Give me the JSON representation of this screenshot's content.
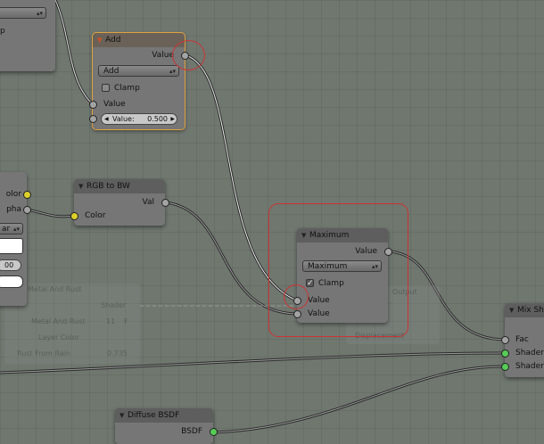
{
  "nodes": {
    "add": {
      "title": "Add",
      "output_label": "Value",
      "operation": "Add",
      "clamp_label": "Clamp",
      "input_label": "Value",
      "slider_label": "Value:",
      "slider_value": "0.500"
    },
    "rgb_to_bw": {
      "title": "RGB to BW",
      "output_label": "Val",
      "input_label": "Color"
    },
    "maximum": {
      "title": "Maximum",
      "output_label": "Value",
      "operation": "Maximum",
      "clamp_label": "Clamp",
      "input1_label": "Value",
      "input2_label": "Value"
    },
    "diffuse": {
      "title": "Diffuse BSDF",
      "output_label": "BSDF"
    },
    "mix_shader": {
      "title": "Mix Sha",
      "input_fac": "Fac",
      "input_shader1": "Shader",
      "input_shader2": "Shader"
    },
    "left_top": {
      "text": "p"
    },
    "left_texture": {
      "out_color": "olor",
      "out_alpha": "pha",
      "field_value": "ar",
      "number_value": "00"
    },
    "ghost_frame": {
      "title": "Metal And Rust",
      "shader_label": "Shader",
      "material_name": "Metal And Rust",
      "user_count": "11",
      "fake_user": "F",
      "layer_color": "Layer Color",
      "rust_label": "Rust From Rain",
      "rust_value": "0.735",
      "output_title": "Output",
      "displacement": "Displacement"
    }
  },
  "colors": {
    "background": "#6f776f",
    "node_body": "#767676",
    "node_header": "#5e5e5e",
    "wire": "#2a2a2a",
    "wire_highlight": "#e8e8e8",
    "socket_value": "#a3a3a3",
    "socket_color": "#dcd02a",
    "socket_shader": "#56cc56",
    "annotation_red": "#cc3333",
    "selected_outline": "#e0a040"
  },
  "icons": [
    "collapse-arrow-icon",
    "dropdown-arrows-icon",
    "checkmark-icon"
  ]
}
